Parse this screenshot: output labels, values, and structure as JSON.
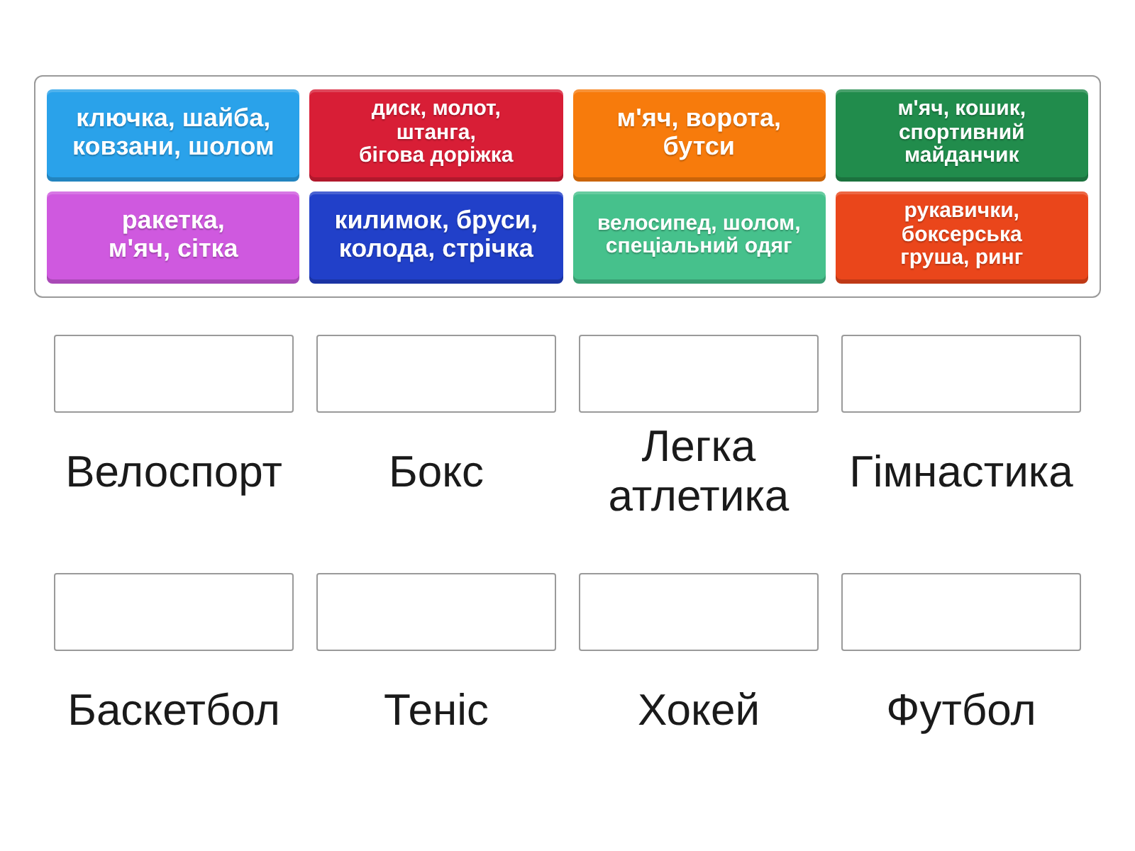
{
  "tiles": [
    {
      "text": "ключка, шайба, ковзани, шолом",
      "color": "#2aa2ea"
    },
    {
      "text": "диск, молот, штанга, бігова доріжка",
      "color": "#d81e36"
    },
    {
      "text": "м'яч, ворота, бутси",
      "color": "#f77b0c"
    },
    {
      "text": "м'яч, кошик, спортивний майданчик",
      "color": "#218c4c"
    },
    {
      "text": "ракетка, м'яч, сітка",
      "color": "#cf59df"
    },
    {
      "text": "килимок, бруси, колода, стрічка",
      "color": "#2140c9"
    },
    {
      "text": "велосипед, шолом, спеціальний одяг",
      "color": "#46c18c"
    },
    {
      "text": "рукавички, боксерська груша, ринг",
      "color": "#ea461b"
    }
  ],
  "targets": [
    {
      "label": "Велоспорт"
    },
    {
      "label": "Бокс"
    },
    {
      "label": "Легка атлетика"
    },
    {
      "label": "Гімнастика"
    },
    {
      "label": "Баскетбол"
    },
    {
      "label": "Теніс"
    },
    {
      "label": "Хокей"
    },
    {
      "label": "Футбол"
    }
  ]
}
